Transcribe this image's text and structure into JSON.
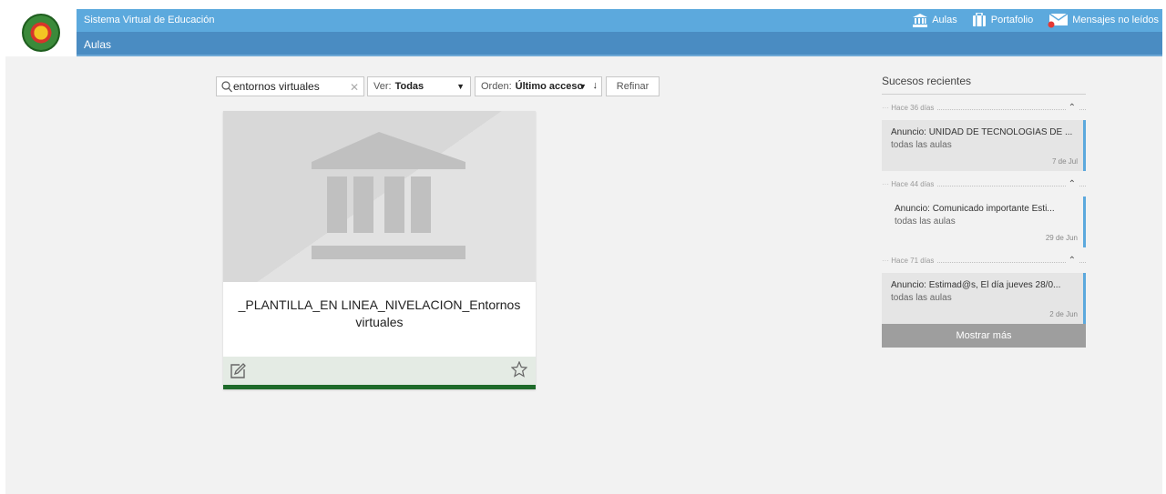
{
  "header": {
    "app_title": "Sistema Virtual de Educación",
    "breadcrumb": "Aulas",
    "nav": {
      "aulas": "Aulas",
      "portafolio": "Portafolio",
      "mensajes": "Mensajes no leídos"
    }
  },
  "filters": {
    "search_value": "entornos virtuales",
    "ver_label": "Ver:",
    "ver_value": "Todas",
    "orden_label": "Orden:",
    "orden_value": "Último acceso",
    "refine_label": "Refinar"
  },
  "course": {
    "title": "_PLANTILLA_EN LINEA_NIVELACION_Entornos virtuales"
  },
  "events": {
    "title": "Sucesos recientes",
    "groups": [
      {
        "label": "Hace 36 días",
        "text": "Anuncio: UNIDAD DE TECNOLOGÍAS DE ...",
        "sub": "todas las aulas",
        "date": "7 de Jul"
      },
      {
        "label": "Hace 44 días",
        "text": "Anuncio: Comunicado importante Esti...",
        "sub": "todas las aulas",
        "date": "29 de Jun"
      },
      {
        "label": "Hace 71 días",
        "text": "Anuncio: Estimad@s, El día jueves 28/0...",
        "sub": "todas las aulas",
        "date": "2 de Jun"
      }
    ],
    "more_label": "Mostrar más"
  },
  "colors": {
    "topbar": "#5ca9dd",
    "subbar": "#4a8cc2",
    "card_accent": "#1e6b2a"
  }
}
